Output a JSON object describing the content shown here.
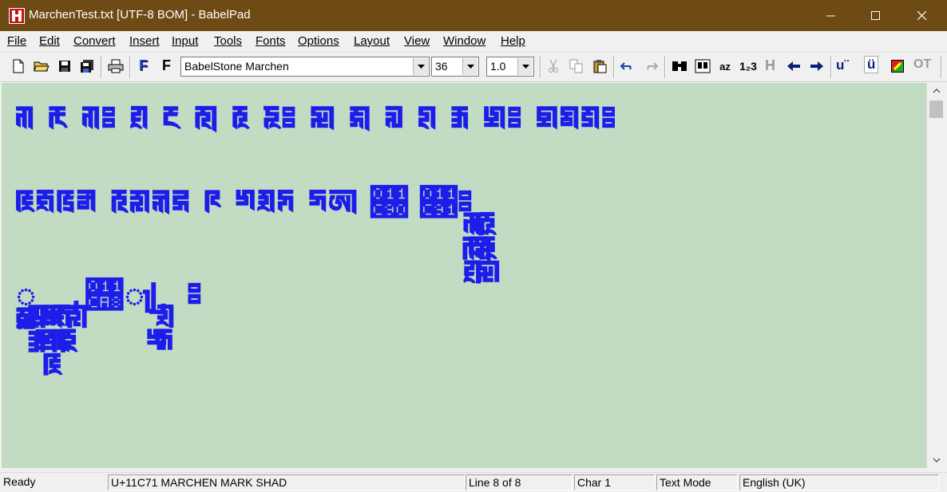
{
  "window": {
    "title": "MarchenTest.txt [UTF-8 BOM] - BabelPad",
    "icon": "babelpad-app-icon",
    "colors": {
      "titlebar": "#6e4a14",
      "editor_bg": "#c2dcc3",
      "text": "#1d1dea"
    }
  },
  "menu": {
    "items": [
      {
        "label": "File"
      },
      {
        "label": "Edit"
      },
      {
        "label": "Convert"
      },
      {
        "label": "Insert"
      },
      {
        "label": "Input"
      },
      {
        "label": "Tools"
      },
      {
        "label": "Fonts"
      },
      {
        "label": "Options"
      },
      {
        "label": "Layout"
      },
      {
        "label": "View"
      },
      {
        "label": "Window"
      },
      {
        "label": "Help"
      }
    ]
  },
  "toolbar": {
    "font_name": "BabelStone Marchen",
    "font_size": "36",
    "line_spacing": "1.0",
    "bold_f_label": "F",
    "plain_f_label": "F",
    "h_label": "H",
    "u_diaeresis_label": "u¨",
    "u_umlaut_label": "ü",
    "ot_label": "OT",
    "az_label": "az",
    "num_label": "1₂3"
  },
  "editor": {
    "lines": [
      "𑱲 𑱳 𑱲𑱱 𑱴 𑱵 𑱶 𑱷 𑱸𑱱 𑱹 𑱺 𑱻 𑱼 𑱽 𑱾𑱱 𑱿𑲀𑲁𑱱",
      "𑲂𑲃𑲄𑲅 𑲆𑲇𑲈𑲉 𑲊 𑲋𑲌𑲍 𑲎𑲏 𑲐 𑲑𑱱 𑲒𑲓𑲔 𑲕𑲖 𑲗𑲘𑲙",
      "𑲚𑲛 𑲜𑲝 𑲞𑲟 𑲠𑲡𑲢 𑲣𑲤 𑲥𑲦 𑲧𑲨𑲩 𑲪𑲫 𑲬𑲭  𑱱"
    ]
  },
  "status": {
    "ready": "Ready",
    "char_info": "U+11C71 MARCHEN MARK SHAD",
    "line_info": "Line 8 of 8",
    "char_pos": "Char 1",
    "mode": "Text Mode",
    "language": "English (UK)"
  }
}
